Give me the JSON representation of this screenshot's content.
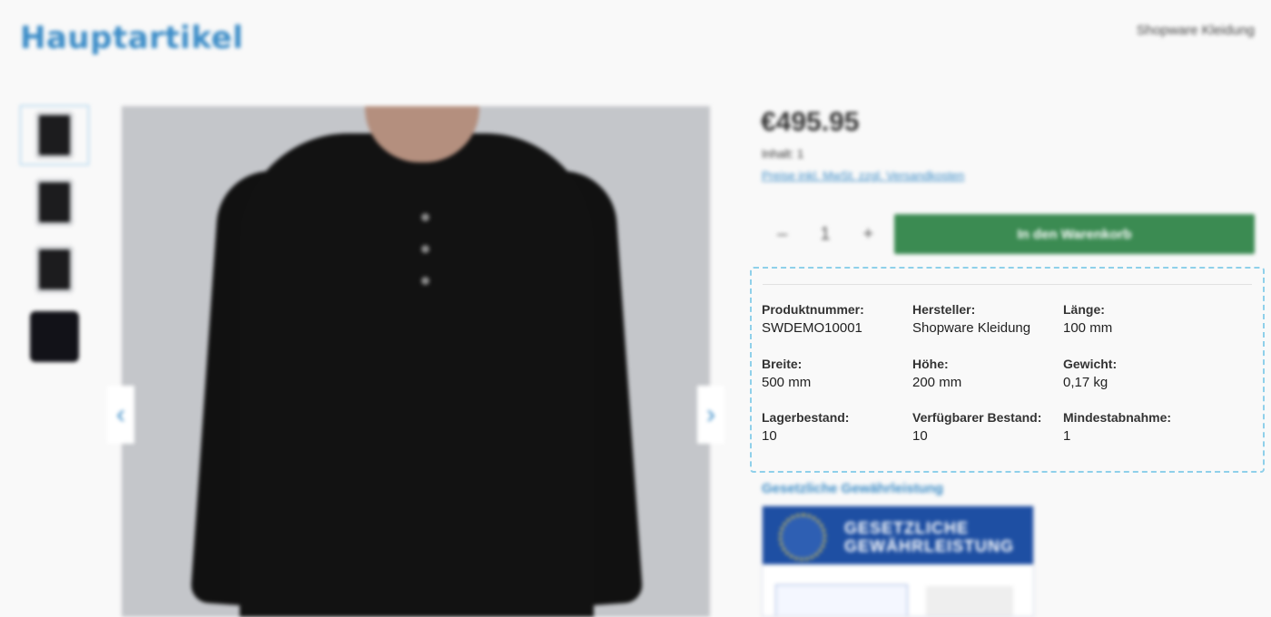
{
  "header": {
    "title": "Hauptartikel",
    "manufacturer": "Shopware Kleidung"
  },
  "gallery": {
    "thumbnails": [
      "product-thumb-1",
      "product-thumb-2",
      "product-thumb-3",
      "product-thumb-4"
    ],
    "prev_icon": "‹",
    "next_icon": "›"
  },
  "buy": {
    "price": "€495.95",
    "content": "Inhalt: 1",
    "tax_note": "Preise inkl. MwSt. zzgl. Versandkosten",
    "quantity": "1",
    "minus": "–",
    "plus": "+",
    "add_to_cart": "In den Warenkorb"
  },
  "properties": {
    "product_number_label": "Produktnummer:",
    "product_number": "SWDEMO10001",
    "manufacturer_label": "Hersteller:",
    "manufacturer": "Shopware Kleidung",
    "length_label": "Länge:",
    "length": "100 mm",
    "width_label": "Breite:",
    "width": "500 mm",
    "height_label": "Höhe:",
    "height": "200 mm",
    "weight_label": "Gewicht:",
    "weight": "0,17 kg",
    "stock_label": "Lagerbestand:",
    "stock": "10",
    "available_stock_label": "Verfügbarer Bestand:",
    "available_stock": "10",
    "min_purchase_label": "Mindestabnahme:",
    "min_purchase": "1"
  },
  "warranty": {
    "title": "Gesetzliche Gewährleistung",
    "badge_line1": "GESETZLICHE",
    "badge_line2": "GEWÄHRLEISTUNG"
  }
}
